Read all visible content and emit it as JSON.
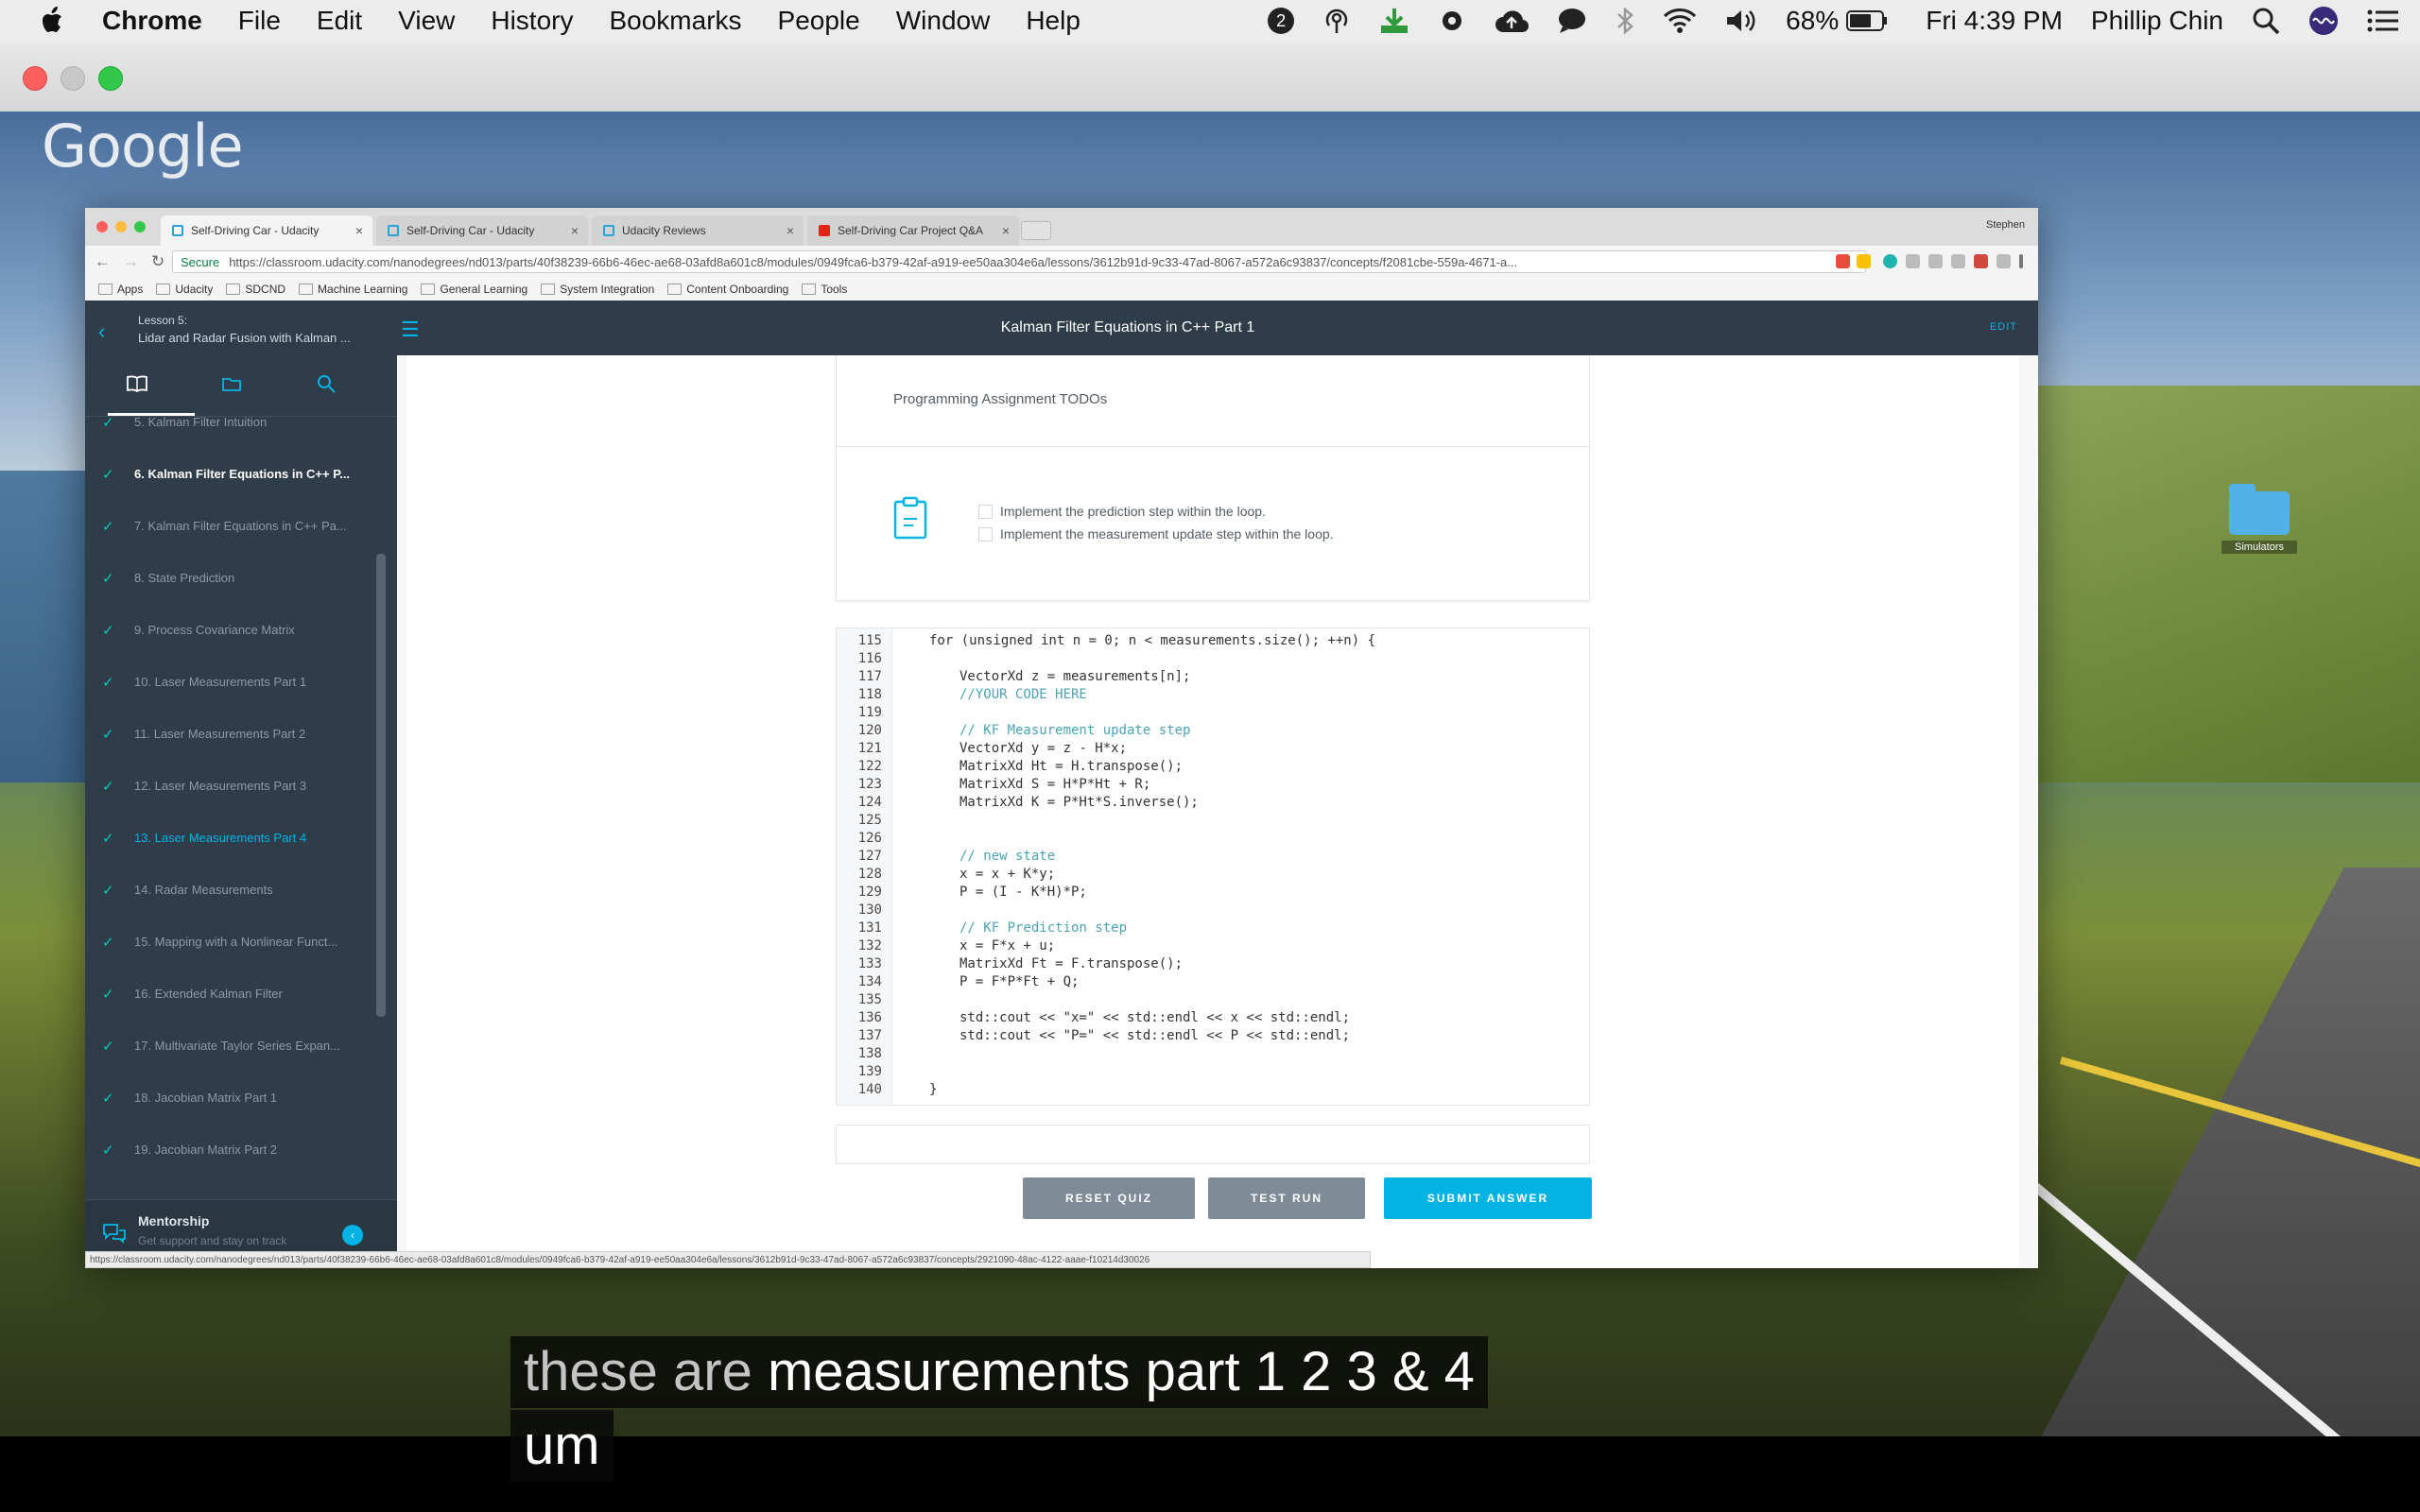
{
  "menubar": {
    "app_name": "Chrome",
    "menus": [
      "File",
      "Edit",
      "View",
      "History",
      "Bookmarks",
      "People",
      "Window",
      "Help"
    ],
    "notification_count": "2",
    "battery": "68%",
    "clock": "Fri 4:39 PM",
    "user": "Phillip Chin"
  },
  "desktop": {
    "google_logo": "Google",
    "folder_label": "Simulators"
  },
  "browser": {
    "tabs": [
      {
        "title": "Self-Driving Car - Udacity",
        "active": true
      },
      {
        "title": "Self-Driving Car - Udacity",
        "active": false
      },
      {
        "title": "Udacity Reviews",
        "active": false
      },
      {
        "title": "Self-Driving Car Project Q&A",
        "active": false
      }
    ],
    "profile": "Stephen",
    "secure_label": "Secure",
    "url": "https://classroom.udacity.com/nanodegrees/nd013/parts/40f38239-66b6-46ec-ae68-03afd8a601c8/modules/0949fca6-b379-42af-a919-ee50aa304e6a/lessons/3612b91d-9c33-47ad-8067-a572a6c93837/concepts/f2081cbe-559a-4671-a...",
    "bookmarks": [
      "Apps",
      "Udacity",
      "SDCND",
      "Machine Learning",
      "General Learning",
      "System Integration",
      "Content Onboarding",
      "Tools"
    ],
    "status_url": "https://classroom.udacity.com/nanodegrees/nd013/parts/40f38239-66b6-46ec-ae68-03afd8a601c8/modules/0949fca6-b379-42af-a919-ee50aa304e6a/lessons/3612b91d-9c33-47ad-8067-a572a6c93837/concepts/2921090-48ac-4122-aaae-f10214d30026"
  },
  "app": {
    "lesson_label": "Lesson 5:",
    "lesson_title": "Lidar and Radar Fusion with Kalman ...",
    "page_title": "Kalman Filter Equations in C++ Part 1",
    "edit_label": "EDIT",
    "sidebar_items": [
      {
        "label": "5. Kalman Filter Intuition",
        "state": "normal"
      },
      {
        "label": "6. Kalman Filter Equations in C++ P...",
        "state": "active"
      },
      {
        "label": "7. Kalman Filter Equations in C++ Pa...",
        "state": "normal"
      },
      {
        "label": "8. State Prediction",
        "state": "normal"
      },
      {
        "label": "9. Process Covariance Matrix",
        "state": "normal"
      },
      {
        "label": "10. Laser Measurements Part 1",
        "state": "normal"
      },
      {
        "label": "11. Laser Measurements Part 2",
        "state": "normal"
      },
      {
        "label": "12. Laser Measurements Part 3",
        "state": "normal"
      },
      {
        "label": "13. Laser Measurements Part 4",
        "state": "hover"
      },
      {
        "label": "14. Radar Measurements",
        "state": "normal"
      },
      {
        "label": "15. Mapping with a Nonlinear Funct...",
        "state": "normal"
      },
      {
        "label": "16. Extended Kalman Filter",
        "state": "normal"
      },
      {
        "label": "17. Multivariate Taylor Series Expan...",
        "state": "normal"
      },
      {
        "label": "18. Jacobian Matrix Part 1",
        "state": "normal"
      },
      {
        "label": "19. Jacobian Matrix Part 2",
        "state": "normal"
      }
    ],
    "mentorship_title": "Mentorship",
    "mentorship_subtitle": "Get support and stay on track",
    "todo_title": "Programming Assignment TODOs",
    "todos": [
      "Implement the prediction step within the loop.",
      "Implement the measurement update step within the loop."
    ],
    "code_lines": [
      {
        "n": "115",
        "indent": 0,
        "text": "for (unsigned int n = 0; n < measurements.size(); ++n) {",
        "kind": "code"
      },
      {
        "n": "116",
        "indent": 0,
        "text": "",
        "kind": "code"
      },
      {
        "n": "117",
        "indent": 1,
        "text": "VectorXd z = measurements[n];",
        "kind": "code"
      },
      {
        "n": "118",
        "indent": 1,
        "text": "//YOUR CODE HERE",
        "kind": "comment"
      },
      {
        "n": "119",
        "indent": 0,
        "text": "",
        "kind": "code"
      },
      {
        "n": "120",
        "indent": 1,
        "text": "// KF Measurement update step",
        "kind": "comment"
      },
      {
        "n": "121",
        "indent": 1,
        "text": "VectorXd y = z - H*x;",
        "kind": "code"
      },
      {
        "n": "122",
        "indent": 1,
        "text": "MatrixXd Ht = H.transpose();",
        "kind": "code"
      },
      {
        "n": "123",
        "indent": 1,
        "text": "MatrixXd S = H*P*Ht + R;",
        "kind": "code"
      },
      {
        "n": "124",
        "indent": 1,
        "text": "MatrixXd K = P*Ht*S.inverse();",
        "kind": "code"
      },
      {
        "n": "125",
        "indent": 0,
        "text": "",
        "kind": "code"
      },
      {
        "n": "126",
        "indent": 0,
        "text": "",
        "kind": "code"
      },
      {
        "n": "127",
        "indent": 1,
        "text": "// new state",
        "kind": "comment"
      },
      {
        "n": "128",
        "indent": 1,
        "text": "x = x + K*y;",
        "kind": "code"
      },
      {
        "n": "129",
        "indent": 1,
        "text": "P = (I - K*H)*P;",
        "kind": "code"
      },
      {
        "n": "130",
        "indent": 0,
        "text": "",
        "kind": "code"
      },
      {
        "n": "131",
        "indent": 1,
        "text": "// KF Prediction step",
        "kind": "comment"
      },
      {
        "n": "132",
        "indent": 1,
        "text": "x = F*x + u;",
        "kind": "code"
      },
      {
        "n": "133",
        "indent": 1,
        "text": "MatrixXd Ft = F.transpose();",
        "kind": "code"
      },
      {
        "n": "134",
        "indent": 1,
        "text": "P = F*P*Ft + Q;",
        "kind": "code"
      },
      {
        "n": "135",
        "indent": 0,
        "text": "",
        "kind": "code"
      },
      {
        "n": "136",
        "indent": 1,
        "text": "std::cout << \"x=\" << std::endl << x << std::endl;",
        "kind": "code"
      },
      {
        "n": "137",
        "indent": 1,
        "text": "std::cout << \"P=\" << std::endl << P << std::endl;",
        "kind": "code"
      },
      {
        "n": "138",
        "indent": 0,
        "text": "",
        "kind": "code"
      },
      {
        "n": "139",
        "indent": 0,
        "text": "",
        "kind": "code"
      },
      {
        "n": "140",
        "indent": 0,
        "text": "}",
        "kind": "code"
      }
    ],
    "buttons": {
      "reset": "RESET QUIZ",
      "test": "TEST RUN",
      "submit": "SUBMIT ANSWER"
    }
  },
  "captions": {
    "line1_dim": "these are",
    "line1_main": "measurements part 1 2 3 & 4",
    "line2": "um"
  }
}
